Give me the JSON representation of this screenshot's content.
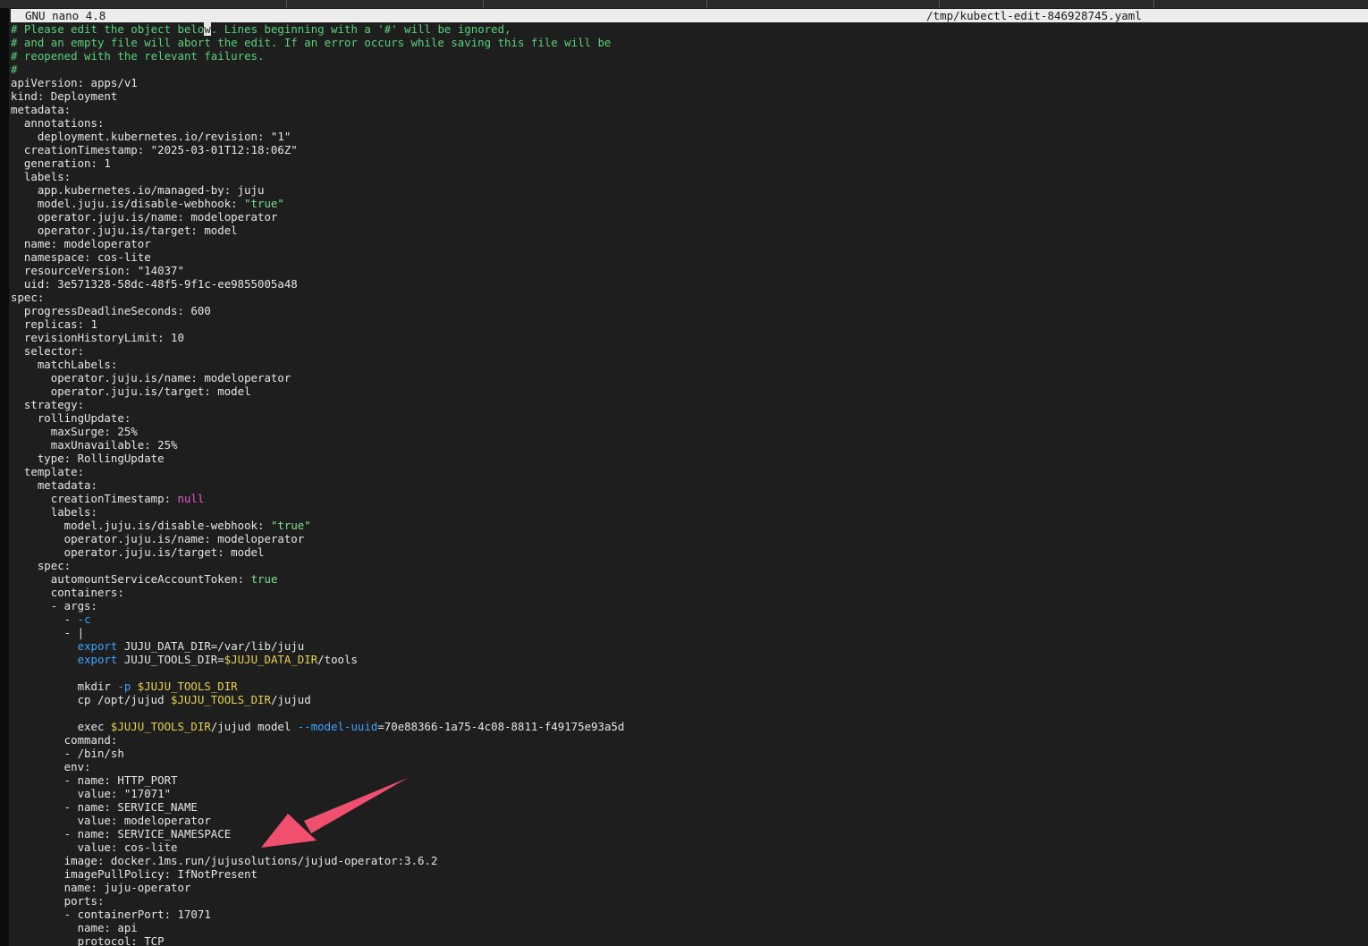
{
  "titlebar": {
    "app": "GNU nano 4.8",
    "file": "/tmp/kubectl-edit-846928745.yaml"
  },
  "lines": [
    [
      {
        "t": "# Please edit the object belo",
        "c": "cm"
      },
      {
        "t": "w",
        "c": "cur"
      },
      {
        "t": ". Lines beginning with a '#' will be ignored,",
        "c": "cm"
      }
    ],
    [
      {
        "t": "# and an empty file will abort the edit. If an error occurs while saving this file will be",
        "c": "cm"
      }
    ],
    [
      {
        "t": "# reopened with the relevant failures.",
        "c": "cm"
      }
    ],
    [
      {
        "t": "#",
        "c": "cm"
      }
    ],
    [
      {
        "t": "apiVersion: apps/v1"
      }
    ],
    [
      {
        "t": "kind: Deployment"
      }
    ],
    [
      {
        "t": "metadata:"
      }
    ],
    [
      {
        "t": "  annotations:"
      }
    ],
    [
      {
        "t": "    deployment.kubernetes.io/revision: \"1\""
      }
    ],
    [
      {
        "t": "  creationTimestamp: \"2025-03-01T12:18:06Z\""
      }
    ],
    [
      {
        "t": "  generation: 1"
      }
    ],
    [
      {
        "t": "  labels:"
      }
    ],
    [
      {
        "t": "    app.kubernetes.io/managed-by: juju"
      }
    ],
    [
      {
        "t": "    model.juju.is/disable-webhook: "
      },
      {
        "t": "\"true\"",
        "c": "str"
      }
    ],
    [
      {
        "t": "    operator.juju.is/name: modeloperator"
      }
    ],
    [
      {
        "t": "    operator.juju.is/target: model"
      }
    ],
    [
      {
        "t": "  name: modeloperator"
      }
    ],
    [
      {
        "t": "  namespace: cos-lite"
      }
    ],
    [
      {
        "t": "  resourceVersion: \"14037\""
      }
    ],
    [
      {
        "t": "  uid: 3e571328-58dc-48f5-9f1c-ee9855005a48"
      }
    ],
    [
      {
        "t": "spec:"
      }
    ],
    [
      {
        "t": "  progressDeadlineSeconds: 600"
      }
    ],
    [
      {
        "t": "  replicas: 1"
      }
    ],
    [
      {
        "t": "  revisionHistoryLimit: 10"
      }
    ],
    [
      {
        "t": "  selector:"
      }
    ],
    [
      {
        "t": "    matchLabels:"
      }
    ],
    [
      {
        "t": "      operator.juju.is/name: modeloperator"
      }
    ],
    [
      {
        "t": "      operator.juju.is/target: model"
      }
    ],
    [
      {
        "t": "  strategy:"
      }
    ],
    [
      {
        "t": "    rollingUpdate:"
      }
    ],
    [
      {
        "t": "      maxSurge: 25%"
      }
    ],
    [
      {
        "t": "      maxUnavailable: 25%"
      }
    ],
    [
      {
        "t": "    type: RollingUpdate"
      }
    ],
    [
      {
        "t": "  template:"
      }
    ],
    [
      {
        "t": "    metadata:"
      }
    ],
    [
      {
        "t": "      creationTimestamp: "
      },
      {
        "t": "null",
        "c": "nul"
      }
    ],
    [
      {
        "t": "      labels:"
      }
    ],
    [
      {
        "t": "        model.juju.is/disable-webhook: "
      },
      {
        "t": "\"true\"",
        "c": "str"
      }
    ],
    [
      {
        "t": "        operator.juju.is/name: modeloperator"
      }
    ],
    [
      {
        "t": "        operator.juju.is/target: model"
      }
    ],
    [
      {
        "t": "    spec:"
      }
    ],
    [
      {
        "t": "      automountServiceAccountToken: "
      },
      {
        "t": "true",
        "c": "str"
      }
    ],
    [
      {
        "t": "      containers:"
      }
    ],
    [
      {
        "t": "      - args:"
      }
    ],
    [
      {
        "t": "        - "
      },
      {
        "t": "-c",
        "c": "kw"
      }
    ],
    [
      {
        "t": "        - |"
      }
    ],
    [
      {
        "t": "          "
      },
      {
        "t": "export",
        "c": "kw"
      },
      {
        "t": " JUJU_DATA_DIR=/var/lib/juju"
      }
    ],
    [
      {
        "t": "          "
      },
      {
        "t": "export",
        "c": "kw"
      },
      {
        "t": " JUJU_TOOLS_DIR="
      },
      {
        "t": "$JUJU_DATA_DIR",
        "c": "var"
      },
      {
        "t": "/tools"
      }
    ],
    [
      {
        "t": ""
      }
    ],
    [
      {
        "t": "          mkdir "
      },
      {
        "t": "-p",
        "c": "kw"
      },
      {
        "t": " "
      },
      {
        "t": "$JUJU_TOOLS_DIR",
        "c": "var"
      }
    ],
    [
      {
        "t": "          cp /opt/jujud "
      },
      {
        "t": "$JUJU_TOOLS_DIR",
        "c": "var"
      },
      {
        "t": "/jujud"
      }
    ],
    [
      {
        "t": ""
      }
    ],
    [
      {
        "t": "          exec "
      },
      {
        "t": "$JUJU_TOOLS_DIR",
        "c": "var"
      },
      {
        "t": "/jujud model "
      },
      {
        "t": "--model-uuid",
        "c": "kw"
      },
      {
        "t": "=70e88366-1a75-4c08-8811-f49175e93a5d"
      }
    ],
    [
      {
        "t": "        command:"
      }
    ],
    [
      {
        "t": "        - /bin/sh"
      }
    ],
    [
      {
        "t": "        env:"
      }
    ],
    [
      {
        "t": "        - name: HTTP_PORT"
      }
    ],
    [
      {
        "t": "          value: \"17071\""
      }
    ],
    [
      {
        "t": "        - name: SERVICE_NAME"
      }
    ],
    [
      {
        "t": "          value: modeloperator"
      }
    ],
    [
      {
        "t": "        - name: SERVICE_NAMESPACE"
      }
    ],
    [
      {
        "t": "          value: cos-lite"
      }
    ],
    [
      {
        "t": "        image: docker.1ms.run/jujusolutions/jujud-operator:3.6.2"
      }
    ],
    [
      {
        "t": "        imagePullPolicy: IfNotPresent"
      }
    ],
    [
      {
        "t": "        name: juju-operator"
      }
    ],
    [
      {
        "t": "        ports:"
      }
    ],
    [
      {
        "t": "        - containerPort: 17071"
      }
    ],
    [
      {
        "t": "          name: api"
      }
    ],
    [
      {
        "t": "          protocol: TCP"
      }
    ]
  ],
  "colors": {
    "background": "#1e1e1e",
    "text": "#e6e6e6",
    "comment": "#57d37a",
    "string": "#7ee08a",
    "keyword": "#3aa6ff",
    "variable": "#e8d24a",
    "null": "#e05ad8",
    "annotation_arrow": "#f0506e"
  },
  "annotation": {
    "icon": "red-arrow-icon"
  }
}
